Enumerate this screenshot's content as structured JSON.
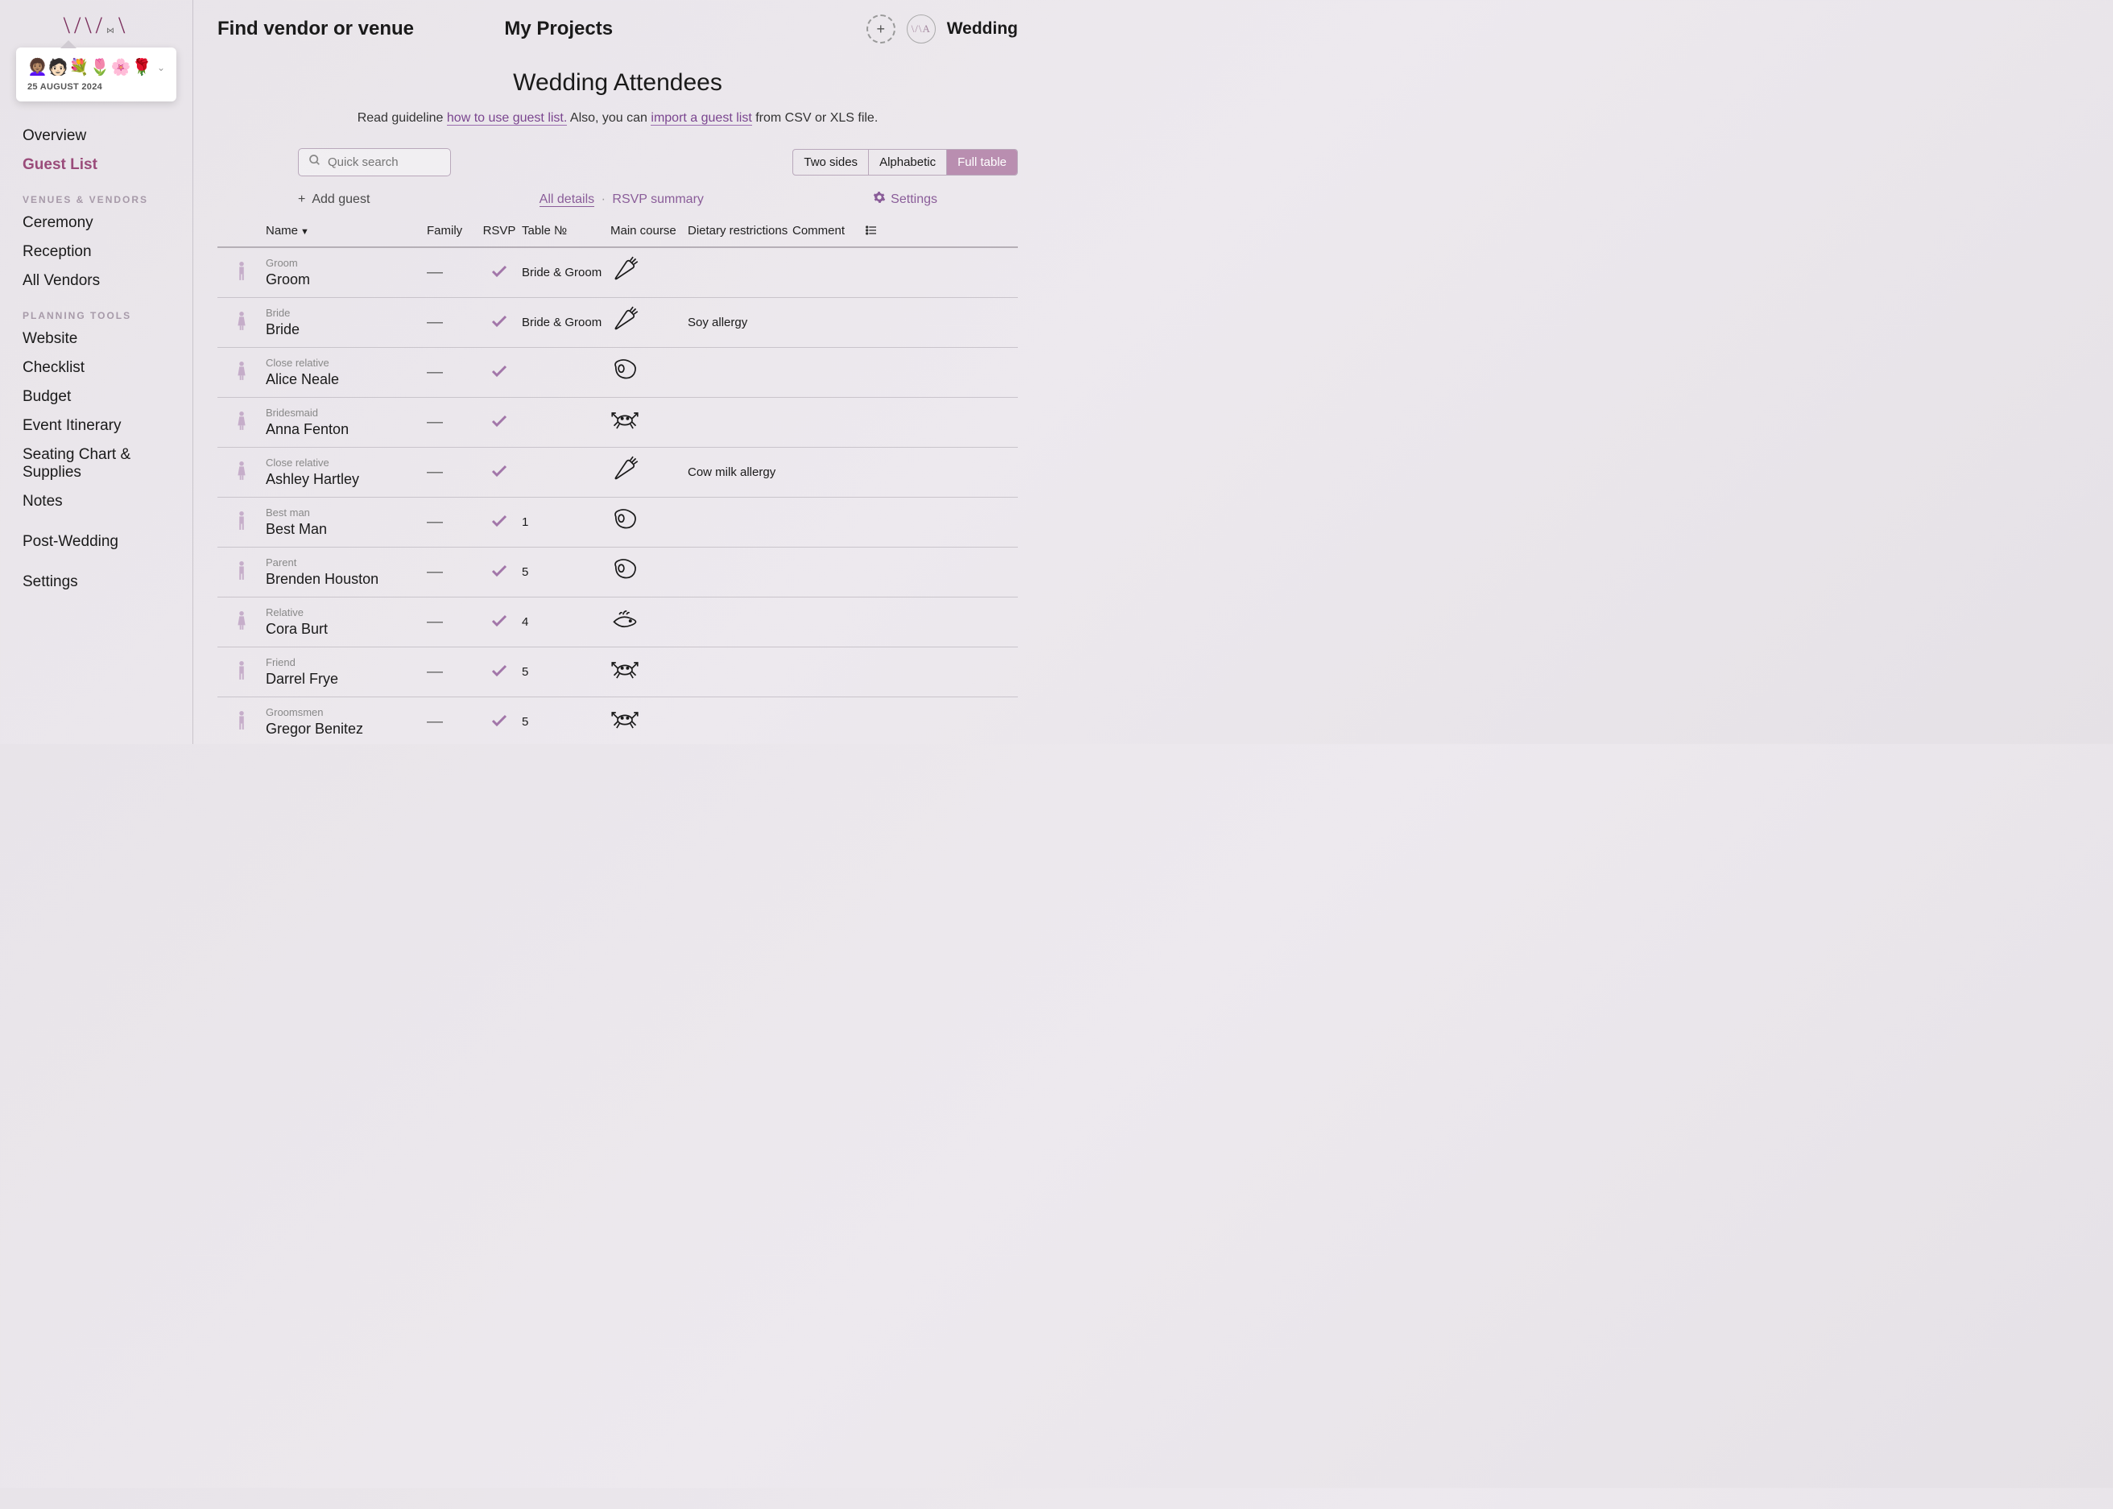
{
  "header": {
    "find": "Find vendor or venue",
    "my_projects": "My Projects",
    "wedding": "Wedding"
  },
  "project_card": {
    "emojis": "👩🏽‍🦱🧑🏻💐🌷🌸🌹",
    "date": "25 AUGUST 2024"
  },
  "sidebar": {
    "overview": "Overview",
    "guest_list": "Guest List",
    "head_venues": "VENUES & VENDORS",
    "ceremony": "Ceremony",
    "reception": "Reception",
    "all_vendors": "All Vendors",
    "head_planning": "PLANNING TOOLS",
    "website": "Website",
    "checklist": "Checklist",
    "budget": "Budget",
    "itinerary": "Event Itinerary",
    "seating": "Seating Chart & Supplies",
    "notes": "Notes",
    "post_wedding": "Post-Wedding",
    "settings": "Settings"
  },
  "page": {
    "title": "Wedding Attendees",
    "guide_prefix": "Read guideline ",
    "guide_link": "how to use guest list.",
    "guide_mid": " Also, you can ",
    "import_link": "import a guest list",
    "guide_suffix": " from CSV or XLS file."
  },
  "search": {
    "placeholder": "Quick search"
  },
  "views": {
    "two_sides": "Two sides",
    "alphabetic": "Alphabetic",
    "full_table": "Full table"
  },
  "toolbar": {
    "add_guest": "Add guest",
    "all_details": "All details",
    "rsvp_summary": "RSVP summary",
    "settings": "Settings"
  },
  "columns": {
    "name": "Name",
    "family": "Family",
    "rsvp": "RSVP",
    "table": "Table №",
    "main_course": "Main course",
    "dietary": "Dietary restrictions",
    "comment": "Comment"
  },
  "guests": [
    {
      "role": "Groom",
      "name": "Groom",
      "family": "—",
      "rsvp": true,
      "table": "Bride & Groom",
      "meal": "carrot",
      "diet": "",
      "gender": "m"
    },
    {
      "role": "Bride",
      "name": "Bride",
      "family": "—",
      "rsvp": true,
      "table": "Bride & Groom",
      "meal": "carrot",
      "diet": "Soy allergy",
      "gender": "f"
    },
    {
      "role": "Close relative",
      "name": "Alice Neale",
      "family": "—",
      "rsvp": true,
      "table": "",
      "meal": "steak",
      "diet": "",
      "gender": "f"
    },
    {
      "role": "Bridesmaid",
      "name": "Anna Fenton",
      "family": "—",
      "rsvp": true,
      "table": "",
      "meal": "crab",
      "diet": "",
      "gender": "f"
    },
    {
      "role": "Close relative",
      "name": "Ashley Hartley",
      "family": "—",
      "rsvp": true,
      "table": "",
      "meal": "carrot",
      "diet": "Cow milk allergy",
      "gender": "f"
    },
    {
      "role": "Best man",
      "name": "Best Man",
      "family": "—",
      "rsvp": true,
      "table": "1",
      "meal": "steak",
      "diet": "",
      "gender": "m"
    },
    {
      "role": "Parent",
      "name": "Brenden Houston",
      "family": "—",
      "rsvp": true,
      "table": "5",
      "meal": "steak",
      "diet": "",
      "gender": "m"
    },
    {
      "role": "Relative",
      "name": "Cora Burt",
      "family": "—",
      "rsvp": true,
      "table": "4",
      "meal": "fish",
      "diet": "",
      "gender": "f"
    },
    {
      "role": "Friend",
      "name": "Darrel Frye",
      "family": "—",
      "rsvp": true,
      "table": "5",
      "meal": "crab",
      "diet": "",
      "gender": "m"
    },
    {
      "role": "Groomsmen",
      "name": "Gregor Benitez",
      "family": "—",
      "rsvp": true,
      "table": "5",
      "meal": "crab",
      "diet": "",
      "gender": "m"
    }
  ]
}
